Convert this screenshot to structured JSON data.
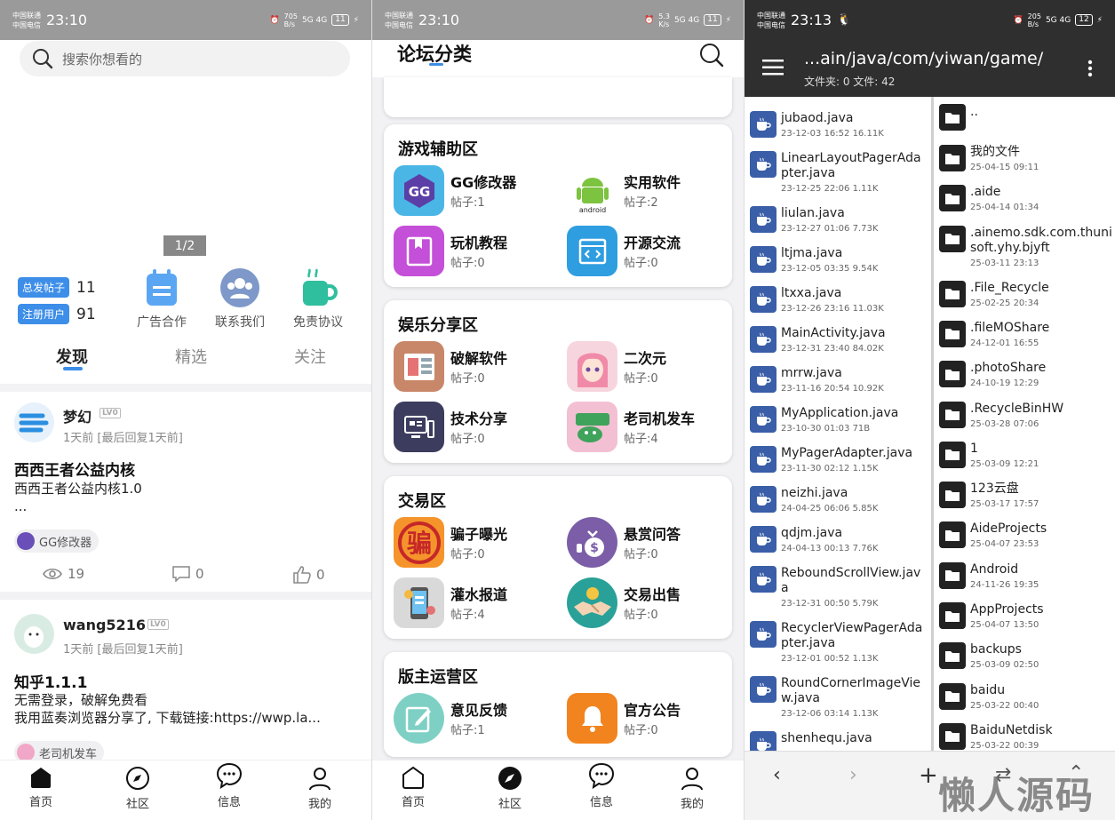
{
  "screen1": {
    "status": {
      "carrier1": "中国联通",
      "carrier2": "中国电信",
      "time": "23:10",
      "speed": "705\nB/s",
      "net": "5G 4G",
      "battery": "11"
    },
    "search_placeholder": "搜索你想看的",
    "pager": "1/2",
    "stats": [
      {
        "label": "总发帖子",
        "value": "11"
      },
      {
        "label": "注册用户",
        "value": "91"
      }
    ],
    "quick_actions": [
      {
        "label": "广告合作",
        "icon": "calendar-icon"
      },
      {
        "label": "联系我们",
        "icon": "group-icon"
      },
      {
        "label": "免责协议",
        "icon": "cup-icon"
      }
    ],
    "tabs": [
      "发现",
      "精选",
      "关注"
    ],
    "posts": [
      {
        "author": "梦幻",
        "level": "LV0",
        "time": "1天前 [最后回复1天前]",
        "title": "西西王者公益内核",
        "body1": "西西王者公益内核1.0",
        "body2": "...",
        "tag": "GG修改器",
        "views": "19",
        "comments": "0",
        "likes": "0"
      },
      {
        "author": "wang5216",
        "level": "LV0",
        "time": "1天前 [最后回复1天前]",
        "title": "知乎1.1.1",
        "body1": "无需登录，破解免费看",
        "body2": "我用蓝奏浏览器分享了, 下载链接:https://wwp.la...",
        "tag": "老司机发车"
      }
    ],
    "nav": [
      "首页",
      "社区",
      "信息",
      "我的"
    ]
  },
  "screen2": {
    "status": {
      "carrier1": "中国联通",
      "carrier2": "中国电信",
      "time": "23:10",
      "speed": "5.3\nK/s",
      "net": "5G 4G",
      "battery": "11"
    },
    "title": "论坛分类",
    "sections": [
      {
        "title": "游戏辅助区",
        "items": [
          {
            "name": "GG修改器",
            "count": "帖子:1"
          },
          {
            "name": "实用软件",
            "count": "帖子:2"
          },
          {
            "name": "玩机教程",
            "count": "帖子:0"
          },
          {
            "name": "开源交流",
            "count": "帖子:0"
          }
        ]
      },
      {
        "title": "娱乐分享区",
        "items": [
          {
            "name": "破解软件",
            "count": "帖子:0"
          },
          {
            "name": "二次元",
            "count": "帖子:0"
          },
          {
            "name": "技术分享",
            "count": "帖子:0"
          },
          {
            "name": "老司机发车",
            "count": "帖子:4"
          }
        ]
      },
      {
        "title": "交易区",
        "items": [
          {
            "name": "骗子曝光",
            "count": "帖子:0"
          },
          {
            "name": "悬赏问答",
            "count": "帖子:0"
          },
          {
            "name": "灌水报道",
            "count": "帖子:4"
          },
          {
            "name": "交易出售",
            "count": "帖子:0"
          }
        ]
      },
      {
        "title": "版主运营区",
        "items": [
          {
            "name": "意见反馈",
            "count": "帖子:1"
          },
          {
            "name": "官方公告",
            "count": "帖子:0"
          }
        ]
      }
    ],
    "android_text": "android",
    "scam_glyph": "骗",
    "nav": [
      "首页",
      "社区",
      "信息",
      "我的"
    ]
  },
  "screen3": {
    "status": {
      "carrier1": "中国联通",
      "carrier2": "中国电信",
      "time": "23:13",
      "speed": "205\nB/s",
      "net": "5G 4G",
      "battery": "12"
    },
    "path": "...ain/java/com/yiwan/game/",
    "summary": "文件夹: 0  文件: 42",
    "left_files": [
      {
        "name": "jubaod.java",
        "meta": "23-12-03 16:52  16.11K"
      },
      {
        "name": "LinearLayoutPagerAdapter.java",
        "meta": "23-12-25 22:06  1.11K"
      },
      {
        "name": "liulan.java",
        "meta": "23-12-27 01:06  7.73K"
      },
      {
        "name": "ltjma.java",
        "meta": "23-12-05 03:35  9.54K"
      },
      {
        "name": "ltxxa.java",
        "meta": "23-12-26 23:16  11.03K"
      },
      {
        "name": "MainActivity.java",
        "meta": "23-12-31 23:40  84.02K"
      },
      {
        "name": "mrrw.java",
        "meta": "23-11-16 20:54  10.92K"
      },
      {
        "name": "MyApplication.java",
        "meta": "23-10-30 01:03  71B"
      },
      {
        "name": "MyPagerAdapter.java",
        "meta": "23-11-30 02:12  1.15K"
      },
      {
        "name": "neizhi.java",
        "meta": "24-04-25 06:06  5.85K"
      },
      {
        "name": "qdjm.java",
        "meta": "24-04-13 00:13  7.76K"
      },
      {
        "name": "ReboundScrollView.java",
        "meta": "23-12-31 00:50  5.79K"
      },
      {
        "name": "RecyclerViewPagerAdapter.java",
        "meta": "23-12-01 00:52  1.13K"
      },
      {
        "name": "RoundCornerImageView.java",
        "meta": "23-12-06 03:14  1.13K"
      },
      {
        "name": "shenhequ.java",
        "meta": ""
      }
    ],
    "right_dirs": [
      {
        "name": "..",
        "meta": ""
      },
      {
        "name": "我的文件",
        "meta": "25-04-15 09:11"
      },
      {
        "name": ".aide",
        "meta": "25-04-14 01:34"
      },
      {
        "name": ".ainemo.sdk.com.thunisoft.yhy.bjyft",
        "meta": "25-03-11 23:13"
      },
      {
        "name": ".File_Recycle",
        "meta": "25-02-25 20:34"
      },
      {
        "name": ".fileMOShare",
        "meta": "24-12-01 16:55"
      },
      {
        "name": ".photoShare",
        "meta": "24-10-19 12:29"
      },
      {
        "name": ".RecycleBinHW",
        "meta": "25-03-28 07:06"
      },
      {
        "name": "1",
        "meta": "25-03-09 12:21"
      },
      {
        "name": "123云盘",
        "meta": "25-03-17 17:57"
      },
      {
        "name": "AideProjects",
        "meta": "25-04-07 23:53"
      },
      {
        "name": "Android",
        "meta": "24-11-26 19:35"
      },
      {
        "name": "AppProjects",
        "meta": "25-04-07 13:50"
      },
      {
        "name": "backups",
        "meta": "25-03-09 02:50"
      },
      {
        "name": "baidu",
        "meta": "25-03-22 00:40"
      },
      {
        "name": "BaiduNetdisk",
        "meta": "25-03-22 00:39"
      }
    ],
    "watermark": "懒人源码"
  }
}
